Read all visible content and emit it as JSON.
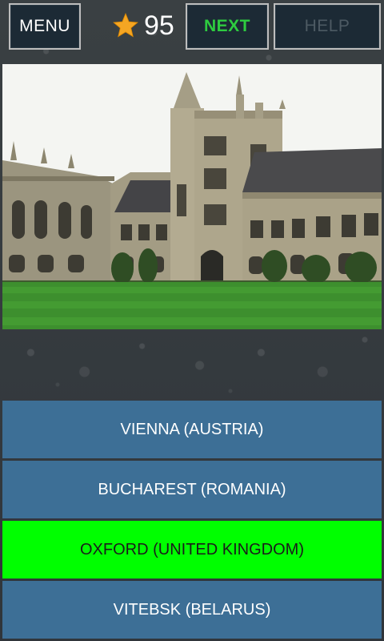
{
  "topbar": {
    "menu_label": "MENU",
    "next_label": "NEXT",
    "help_label": "HELP",
    "score": "95",
    "score_icon": "star-icon"
  },
  "photo": {
    "subject": "gothic-college-building-photo"
  },
  "answers": [
    {
      "label": "VIENNA (AUSTRIA)",
      "state": "default"
    },
    {
      "label": "BUCHAREST (ROMANIA)",
      "state": "default"
    },
    {
      "label": "OXFORD (UNITED KINGDOM)",
      "state": "correct"
    },
    {
      "label": "VITEBSK (BELARUS)",
      "state": "default"
    }
  ],
  "colors": {
    "button_bg": "#1c2a35",
    "next_text": "#2ecc40",
    "help_text_disabled": "#4d5a63",
    "answer_bg": "#3d6f96",
    "answer_correct_bg": "#00ff00",
    "star": "#f5a623"
  }
}
